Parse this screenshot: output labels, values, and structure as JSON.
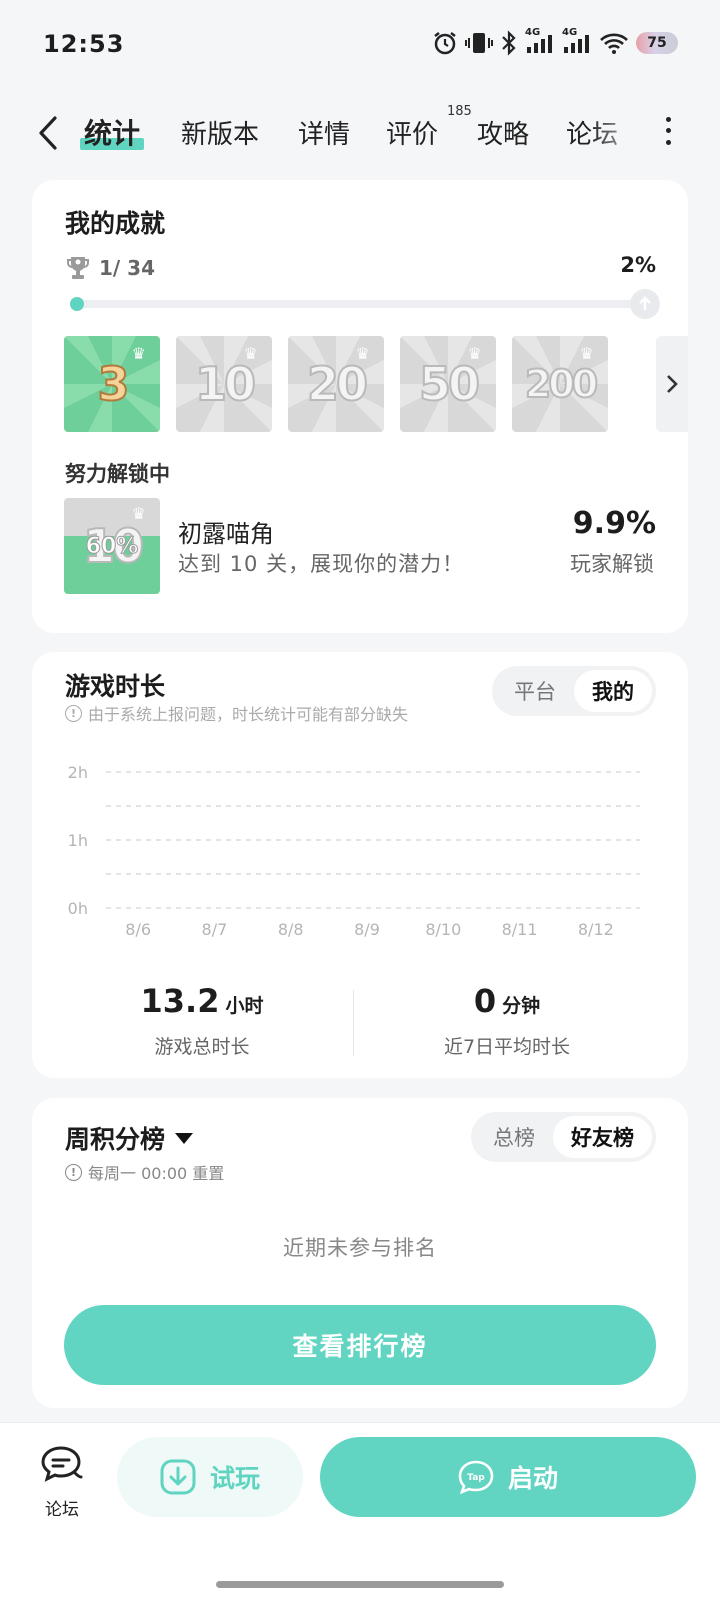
{
  "status_bar": {
    "time": "12:53",
    "network_1": "4G",
    "network_2": "4G",
    "battery": "75"
  },
  "tabs": [
    {
      "label": "统计",
      "active": true
    },
    {
      "label": "新版本"
    },
    {
      "label": "详情"
    },
    {
      "label": "评价",
      "badge": "185"
    },
    {
      "label": "攻略"
    },
    {
      "label": "论坛"
    }
  ],
  "achievements": {
    "title": "我的成就",
    "count": "1/ 34",
    "percent": "2%",
    "progress_fraction": 0.02,
    "badges": [
      {
        "label": "3",
        "unlocked": true
      },
      {
        "label": "10",
        "unlocked": false
      },
      {
        "label": "20",
        "unlocked": false
      },
      {
        "label": "50",
        "unlocked": false
      },
      {
        "label": "200",
        "unlocked": false
      }
    ],
    "in_progress_label": "努力解锁中",
    "in_progress": {
      "badge_label": "10",
      "badge_progress": "60%",
      "name": "初露喵角",
      "description": "达到 10 关，展现你的潜力！",
      "rate": "9.9%",
      "rate_label": "玩家解锁"
    }
  },
  "playtime": {
    "title": "游戏时长",
    "hint": "由于系统上报问题，时长统计可能有部分缺失",
    "toggle": [
      "平台",
      "我的"
    ],
    "toggle_selected": "我的",
    "total_value": "13.2",
    "total_unit": "小时",
    "total_label": "游戏总时长",
    "avg_value": "0",
    "avg_unit": "分钟",
    "avg_label": "近7日平均时长"
  },
  "chart_data": {
    "type": "bar",
    "categories": [
      "8/6",
      "8/7",
      "8/8",
      "8/9",
      "8/10",
      "8/11",
      "8/12"
    ],
    "values": [
      0,
      0,
      0,
      0,
      0,
      0,
      0
    ],
    "y_ticks": [
      "0h",
      "1h",
      "2h"
    ],
    "ylim": [
      0,
      2
    ],
    "grid": true
  },
  "leaderboard": {
    "title": "周积分榜",
    "hint": "每周一 00:00 重置",
    "toggle": [
      "总榜",
      "好友榜"
    ],
    "toggle_selected": "好友榜",
    "empty_text": "近期未参与排名",
    "button_label": "查看排行榜"
  },
  "bottom_bar": {
    "forum_label": "论坛",
    "trial_label": "试玩",
    "launch_label": "启动",
    "launch_logo_text": "Tap"
  },
  "colors": {
    "accent": "#5fd4c0",
    "button": "#62d5c2",
    "background": "#f5f6f8"
  }
}
